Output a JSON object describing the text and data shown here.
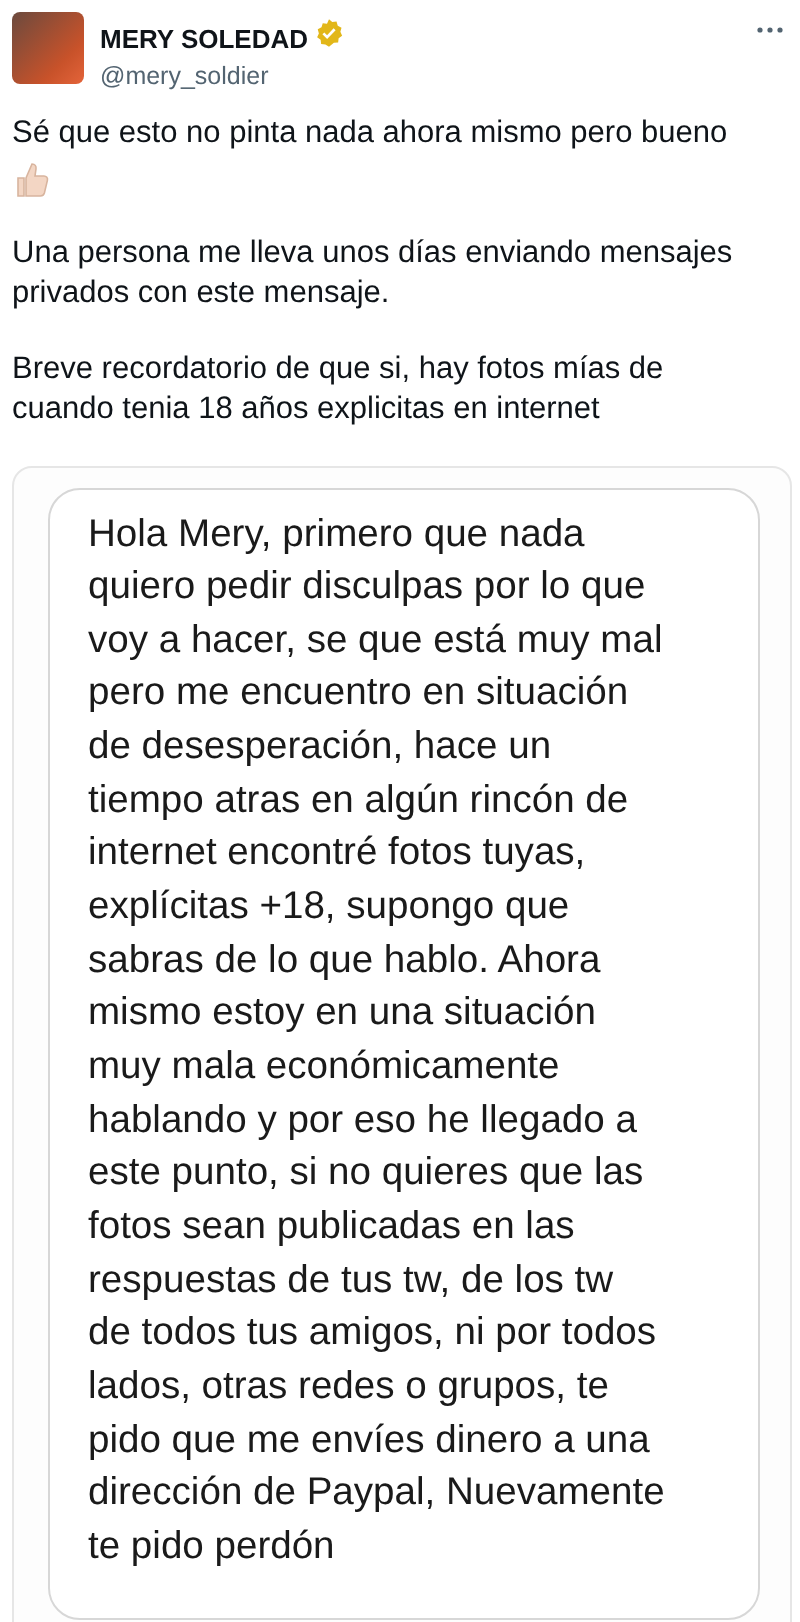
{
  "author": {
    "name": "MERY SOLEDAD",
    "handle": "@mery_soldier",
    "verified": true
  },
  "tweet": {
    "paragraphs": [
      {
        "lines": [
          "Sé que esto no pinta nada ahora mismo pero bueno"
        ],
        "thumbs_up": true
      },
      {
        "lines": [
          "Una persona me lleva unos días enviando mensajes",
          "privados con este mensaje."
        ],
        "thumbs_up": false
      },
      {
        "lines": [
          "Breve recordatorio de que si, hay fotos mías de",
          "cuando tenia 18 años explicitas en internet"
        ],
        "thumbs_up": false
      }
    ]
  },
  "attached_image": {
    "message_lines": [
      "Hola Mery, primero que nada",
      "quiero pedir disculpas por lo que",
      "voy a hacer, se que está muy mal",
      "pero me encuentro en situación",
      "de desesperación, hace un",
      "tiempo atras en algún rincón de",
      "internet encontré fotos tuyas,",
      "explícitas +18, supongo que",
      "sabras de lo que hablo. Ahora",
      "mismo estoy en una situación",
      "muy mala económicamente",
      "hablando y por eso he llegado a",
      "este punto, si no quieres que las",
      "fotos sean publicadas en las",
      "respuestas de tus tw, de los tw",
      "de todos tus amigos, ni por todos",
      "lados, otras redes o grupos, te",
      "pido que me envíes dinero a una",
      "dirección de Paypal, Nuevamente",
      "te pido perdón"
    ]
  }
}
